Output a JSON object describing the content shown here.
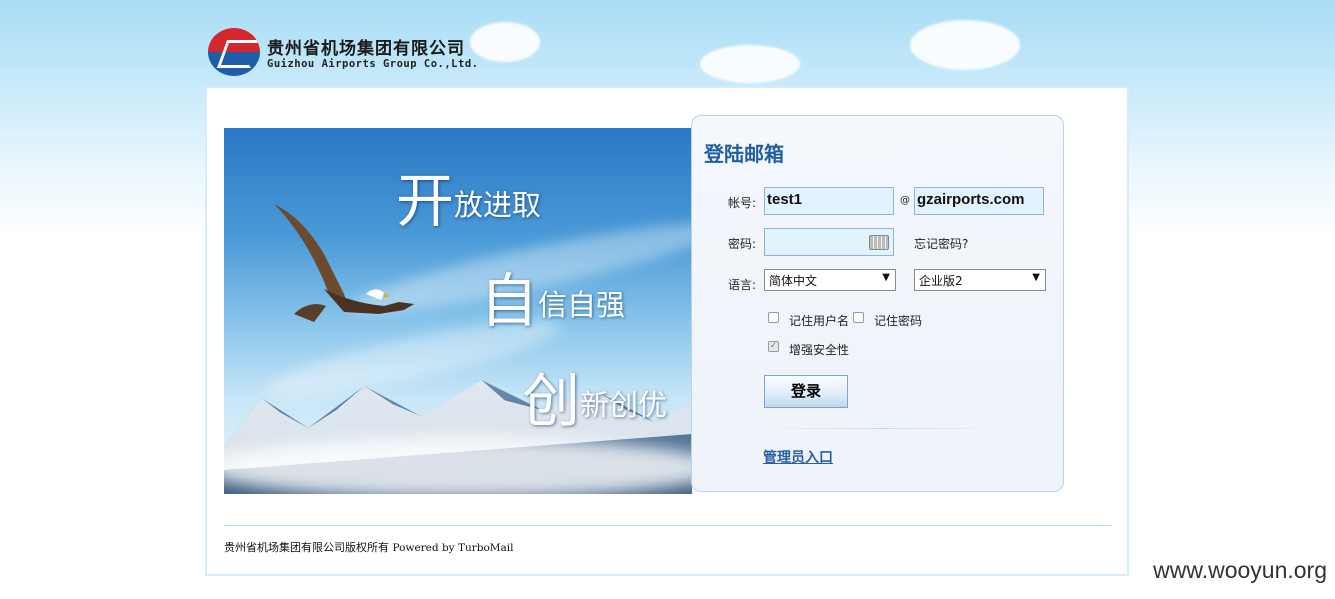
{
  "company": {
    "name_cn": "贵州省机场集团有限公司",
    "name_en": "Guizhou Airports Group Co.,Ltd."
  },
  "banner": {
    "line1_big": "开",
    "line1_rest": "放进取",
    "line2_big": "自",
    "line2_rest": "信自强",
    "line3_big": "创",
    "line3_rest": "新创优"
  },
  "login": {
    "title": "登陆邮箱",
    "account_label": "帐号:",
    "account_value": "test1",
    "at_sign": "@",
    "domain_value": "gzairports.com",
    "password_label": "密码:",
    "password_value": "",
    "forgot_password": "忘记密码?",
    "language_label": "语言:",
    "language_selected": "简体中文",
    "edition_selected": "企业版2",
    "remember_username": "记住用户名",
    "remember_password": "记住密码",
    "enhance_security": "增强安全性",
    "submit_label": "登录",
    "admin_link": "管理员入口"
  },
  "footer": {
    "copyright": "贵州省机场集团有限公司版权所有",
    "powered_by": "Powered by TurboMail"
  },
  "watermark": "www.wooyun.org",
  "colors": {
    "title_blue": "#1f5f9e",
    "input_bg": "#e3f3fd",
    "logo_red": "#d4262c",
    "logo_blue": "#1f5da8"
  }
}
